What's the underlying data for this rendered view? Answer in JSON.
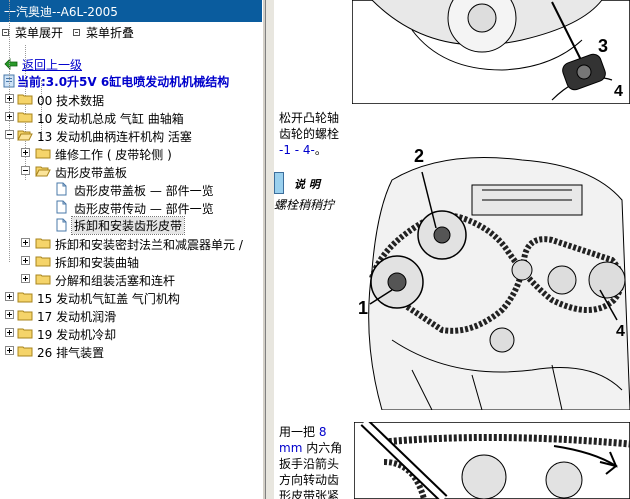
{
  "window": {
    "title": "一汽奥迪--A6L-2005"
  },
  "menubar": {
    "expand_label": "菜单展开",
    "collapse_label": "菜单折叠"
  },
  "nav": {
    "back_label": "返回上一级",
    "current_label": "当前:3.0升5V 6缸电喷发动机机械结构"
  },
  "tree": [
    {
      "label": "00 技术数据"
    },
    {
      "label": "10 发动机总成 气缸 曲轴箱"
    },
    {
      "label": "13 发动机曲柄连杆机构 活塞"
    },
    {
      "label": "维修工作 ( 皮带轮侧 )"
    },
    {
      "label": "齿形皮带盖板"
    },
    {
      "label": "齿形皮带盖板 — 部件一览"
    },
    {
      "label": "齿形皮带传动 — 部件一览"
    },
    {
      "label": "拆卸和安装齿形皮带"
    },
    {
      "label": "拆卸和安装密封法兰和减震器单元 /"
    },
    {
      "label": "拆卸和安装曲轴"
    },
    {
      "label": "分解和组装活塞和连杆"
    },
    {
      "label": "15 发动机气缸盖 气门机构"
    },
    {
      "label": "17 发动机润滑"
    },
    {
      "label": "19 发动机冷却"
    },
    {
      "label": "26 排气装置"
    }
  ],
  "content": {
    "step1_line1": "松开凸轮轴",
    "step1_line2": "齿轮的螺栓",
    "step1_refs": "-1 - 4-",
    "step1_end": "。",
    "note_label": "说 明",
    "note_text": "螺栓稍稍拧",
    "step2_line1a": "用一把",
    "step2_size": "8",
    "step2_unit": "mm",
    "step2_line2b": "内六角",
    "step2_line3": "扳手沿箭头",
    "step2_line4": "方向转动齿",
    "step2_line5": "形皮带张紧",
    "callouts": {
      "c1": "1",
      "c2": "2",
      "c3": "3",
      "c4": "4"
    }
  },
  "colors": {
    "titlebar_bg": "#0a5c9e",
    "link": "#0000cc",
    "folder": "#f5d46a",
    "note_box": "#9ad0ee"
  },
  "icons": {
    "back": "back-arrow-icon",
    "current": "document-icon",
    "folder": "folder-icon",
    "page": "page-icon"
  }
}
